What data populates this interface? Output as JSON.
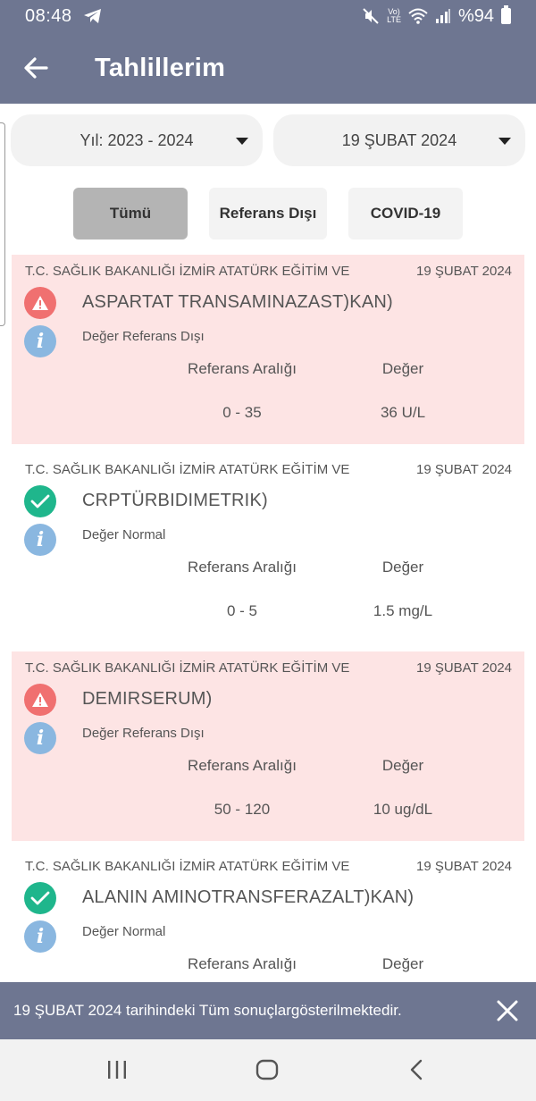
{
  "status_bar": {
    "time": "08:48",
    "battery": "%94"
  },
  "app_bar": {
    "title": "Tahlillerim"
  },
  "filters": {
    "year": "Yıl: 2023 - 2024",
    "date": "19 ŞUBAT 2024"
  },
  "tabs": [
    {
      "label": "Tümü",
      "active": true
    },
    {
      "label": "Referans Dışı",
      "active": false
    },
    {
      "label": "COVID-19",
      "active": false
    }
  ],
  "results": [
    {
      "hospital": "T.C. SAĞLIK BAKANLIĞI İZMİR ATATÜRK EĞİTİM VE",
      "date": "19 ŞUBAT 2024",
      "name": "ASPARTAT TRANSAMINAZAST)KAN)",
      "status": "Değer Referans Dışı",
      "range_label": "Referans Aralığı",
      "value_label": "Değer",
      "range": "0 - 35",
      "value": "36 U/L"
    },
    {
      "hospital": "T.C. SAĞLIK BAKANLIĞI İZMİR ATATÜRK EĞİTİM VE",
      "date": "19 ŞUBAT 2024",
      "name": "CRPTÜRBIDIMETRIK)",
      "status": "Değer Normal",
      "range_label": "Referans Aralığı",
      "value_label": "Değer",
      "range": "0 - 5",
      "value": "1.5 mg/L"
    },
    {
      "hospital": "T.C. SAĞLIK BAKANLIĞI İZMİR ATATÜRK EĞİTİM VE",
      "date": "19 ŞUBAT 2024",
      "name": "DEMIRSERUM)",
      "status": "Değer Referans Dışı",
      "range_label": "Referans Aralığı",
      "value_label": "Değer",
      "range": "50 - 120",
      "value": "10 ug/dL"
    },
    {
      "hospital": "T.C. SAĞLIK BAKANLIĞI İZMİR ATATÜRK EĞİTİM VE",
      "date": "19 ŞUBAT 2024",
      "name": "ALANIN AMINOTRANSFERAZALT)KAN)",
      "status": "Değer Normal",
      "range_label": "Referans Aralığı",
      "value_label": "Değer",
      "range": "",
      "value": ""
    }
  ],
  "snackbar": {
    "message": "19 ŞUBAT 2024 tarihindeki Tüm sonuçlargösterilmektedir."
  },
  "colors": {
    "header": "#6e7691",
    "danger_bg": "#fde4e4",
    "warn_icon": "#f07070",
    "ok_icon": "#1fb68c",
    "info_icon": "#8ab7e0"
  }
}
